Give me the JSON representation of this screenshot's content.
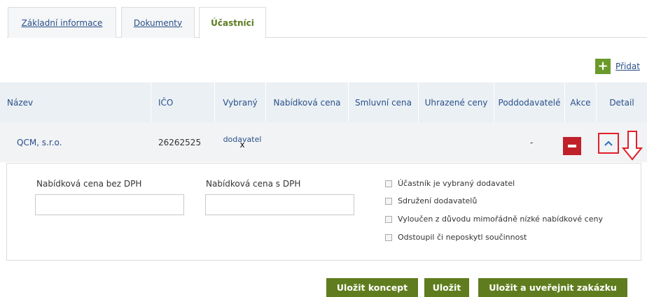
{
  "tabs": [
    {
      "label": "Základní informace"
    },
    {
      "label": "Dokumenty"
    },
    {
      "label": "Účastníci"
    }
  ],
  "add": {
    "label": "Přidat",
    "icon": "plus-icon"
  },
  "table": {
    "headers": [
      "Název",
      "IČO",
      "Vybraný",
      "Nabídková cena",
      "Smluvní cena",
      "Uhrazené ceny",
      "Poddodavatelé",
      "Akce",
      "Detail"
    ],
    "row": {
      "name": "QCM, s.r.o.",
      "ico": "26262525",
      "vybrany_label": "dodavatel",
      "vybrany_mark": "x",
      "poddodavatele": "-"
    }
  },
  "detail": {
    "price_without_vat_label": "Nabídková cena bez DPH",
    "price_without_vat_value": "",
    "price_with_vat_label": "Nabídková cena s DPH",
    "price_with_vat_value": "",
    "checkboxes": [
      {
        "label": "Účastník je vybraný dodavatel",
        "checked": false
      },
      {
        "label": "Sdružení dodavatelů",
        "checked": false
      },
      {
        "label": "Vyloučen z důvodu mimořádně nízké nabídkové ceny",
        "checked": false
      },
      {
        "label": "Odstoupil či neposkytl součinnost",
        "checked": false
      }
    ]
  },
  "buttons": {
    "save_draft": "Uložit koncept",
    "save": "Uložit",
    "save_publish": "Uložit a uveřejnit zakázku"
  },
  "colors": {
    "primary_green": "#5f7d1e",
    "danger_red": "#c0202a",
    "link_blue": "#2a4f8a"
  }
}
